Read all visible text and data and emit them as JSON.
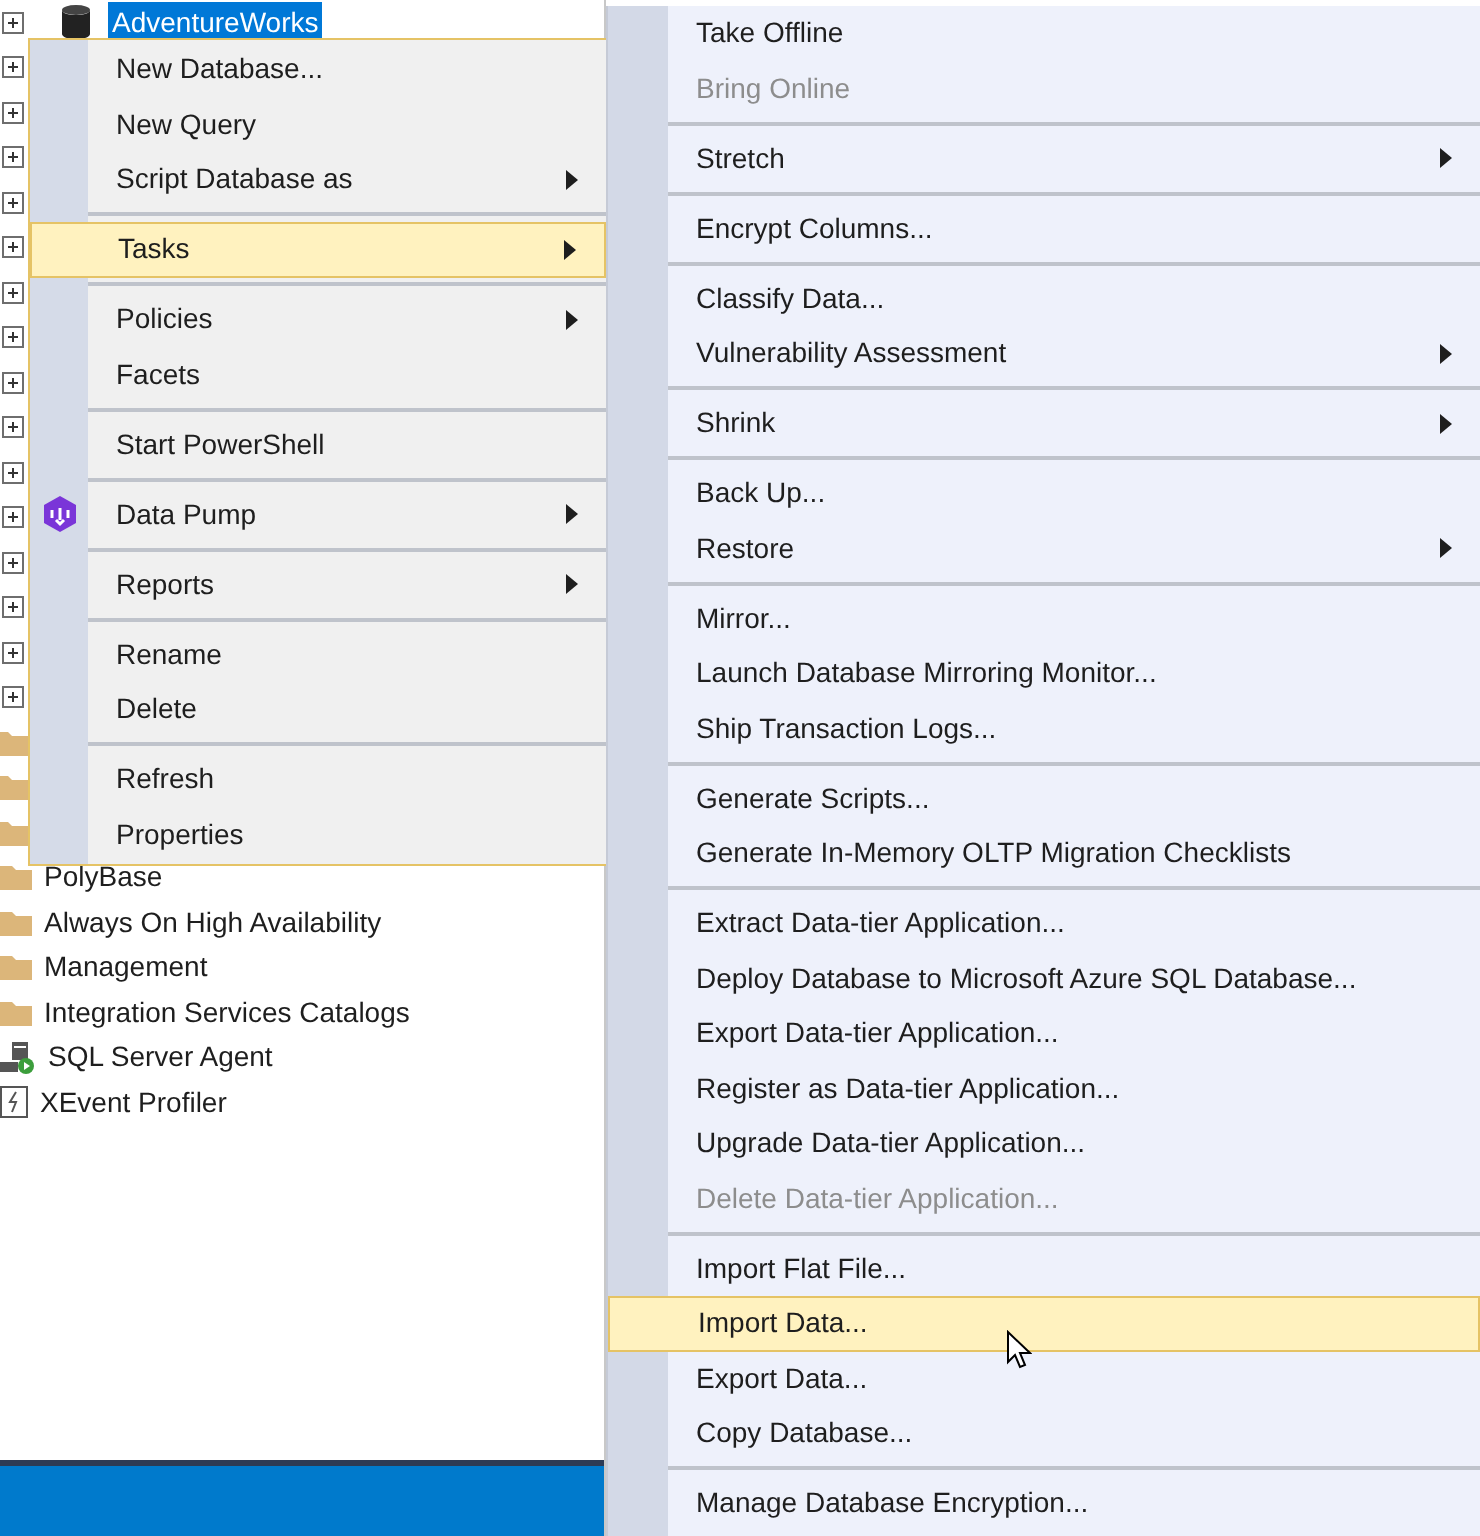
{
  "object_explorer": {
    "root_node": {
      "label": "AdventureWorks",
      "selected": true,
      "expanded": false
    },
    "hidden_nodes": [
      {
        "kind": "expander"
      },
      {
        "kind": "expander"
      },
      {
        "kind": "expander"
      },
      {
        "kind": "expander"
      },
      {
        "kind": "expander"
      },
      {
        "kind": "expander"
      },
      {
        "kind": "expander"
      },
      {
        "kind": "expander"
      },
      {
        "kind": "expander"
      },
      {
        "kind": "expander"
      },
      {
        "kind": "expander"
      },
      {
        "kind": "expander"
      },
      {
        "kind": "expander"
      },
      {
        "kind": "expander"
      },
      {
        "kind": "expander"
      },
      {
        "kind": "folder"
      },
      {
        "kind": "folder"
      },
      {
        "kind": "folder"
      }
    ],
    "nodes": [
      {
        "kind": "folder",
        "label": "PolyBase"
      },
      {
        "kind": "folder",
        "label": "Always On High Availability"
      },
      {
        "kind": "folder",
        "label": "Management"
      },
      {
        "kind": "folder",
        "label": "Integration Services Catalogs"
      },
      {
        "kind": "agent",
        "label": "SQL Server Agent"
      },
      {
        "kind": "profiler",
        "label": "XEvent Profiler"
      }
    ]
  },
  "context_menu": {
    "groups": [
      [
        {
          "label": "New Database...",
          "submenu": false,
          "selected": false,
          "has_icon": false
        },
        {
          "label": "New Query",
          "submenu": false,
          "selected": false,
          "has_icon": false
        },
        {
          "label": "Script Database as",
          "submenu": true,
          "selected": false,
          "has_icon": false
        }
      ],
      [
        {
          "label": "Tasks",
          "submenu": true,
          "selected": true,
          "has_icon": false
        }
      ],
      [
        {
          "label": "Policies",
          "submenu": true,
          "selected": false,
          "has_icon": false
        },
        {
          "label": "Facets",
          "submenu": false,
          "selected": false,
          "has_icon": false
        }
      ],
      [
        {
          "label": "Start PowerShell",
          "submenu": false,
          "selected": false,
          "has_icon": false
        }
      ],
      [
        {
          "label": "Data Pump",
          "submenu": true,
          "selected": false,
          "has_icon": true
        }
      ],
      [
        {
          "label": "Reports",
          "submenu": true,
          "selected": false,
          "has_icon": false
        }
      ],
      [
        {
          "label": "Rename",
          "submenu": false,
          "selected": false,
          "has_icon": false
        },
        {
          "label": "Delete",
          "submenu": false,
          "selected": false,
          "has_icon": false
        }
      ],
      [
        {
          "label": "Refresh",
          "submenu": false,
          "selected": false,
          "has_icon": false
        },
        {
          "label": "Properties",
          "submenu": false,
          "selected": false,
          "has_icon": false
        }
      ]
    ]
  },
  "tasks_submenu": {
    "groups": [
      [
        {
          "label": "Take Offline",
          "submenu": false,
          "selected": false,
          "disabled": false
        },
        {
          "label": "Bring Online",
          "submenu": false,
          "selected": false,
          "disabled": true
        }
      ],
      [
        {
          "label": "Stretch",
          "submenu": true,
          "selected": false,
          "disabled": false
        }
      ],
      [
        {
          "label": "Encrypt Columns...",
          "submenu": false,
          "selected": false,
          "disabled": false
        }
      ],
      [
        {
          "label": "Classify Data...",
          "submenu": false,
          "selected": false,
          "disabled": false
        },
        {
          "label": "Vulnerability Assessment",
          "submenu": true,
          "selected": false,
          "disabled": false
        }
      ],
      [
        {
          "label": "Shrink",
          "submenu": true,
          "selected": false,
          "disabled": false
        }
      ],
      [
        {
          "label": "Back Up...",
          "submenu": false,
          "selected": false,
          "disabled": false
        },
        {
          "label": "Restore",
          "submenu": true,
          "selected": false,
          "disabled": false
        }
      ],
      [
        {
          "label": "Mirror...",
          "submenu": false,
          "selected": false,
          "disabled": false
        },
        {
          "label": "Launch Database Mirroring Monitor...",
          "submenu": false,
          "selected": false,
          "disabled": false
        },
        {
          "label": "Ship Transaction Logs...",
          "submenu": false,
          "selected": false,
          "disabled": false
        }
      ],
      [
        {
          "label": "Generate Scripts...",
          "submenu": false,
          "selected": false,
          "disabled": false
        },
        {
          "label": "Generate In-Memory OLTP Migration Checklists",
          "submenu": false,
          "selected": false,
          "disabled": false
        }
      ],
      [
        {
          "label": "Extract Data-tier Application...",
          "submenu": false,
          "selected": false,
          "disabled": false
        },
        {
          "label": "Deploy Database to Microsoft Azure SQL Database...",
          "submenu": false,
          "selected": false,
          "disabled": false
        },
        {
          "label": "Export Data-tier Application...",
          "submenu": false,
          "selected": false,
          "disabled": false
        },
        {
          "label": "Register as Data-tier Application...",
          "submenu": false,
          "selected": false,
          "disabled": false
        },
        {
          "label": "Upgrade Data-tier Application...",
          "submenu": false,
          "selected": false,
          "disabled": false
        },
        {
          "label": "Delete Data-tier Application...",
          "submenu": false,
          "selected": false,
          "disabled": true
        }
      ],
      [
        {
          "label": "Import Flat File...",
          "submenu": false,
          "selected": false,
          "disabled": false
        },
        {
          "label": "Import Data...",
          "submenu": false,
          "selected": true,
          "disabled": false
        },
        {
          "label": "Export Data...",
          "submenu": false,
          "selected": false,
          "disabled": false
        },
        {
          "label": "Copy Database...",
          "submenu": false,
          "selected": false,
          "disabled": false
        }
      ],
      [
        {
          "label": "Manage Database Encryption...",
          "submenu": false,
          "selected": false,
          "disabled": false
        }
      ]
    ]
  }
}
